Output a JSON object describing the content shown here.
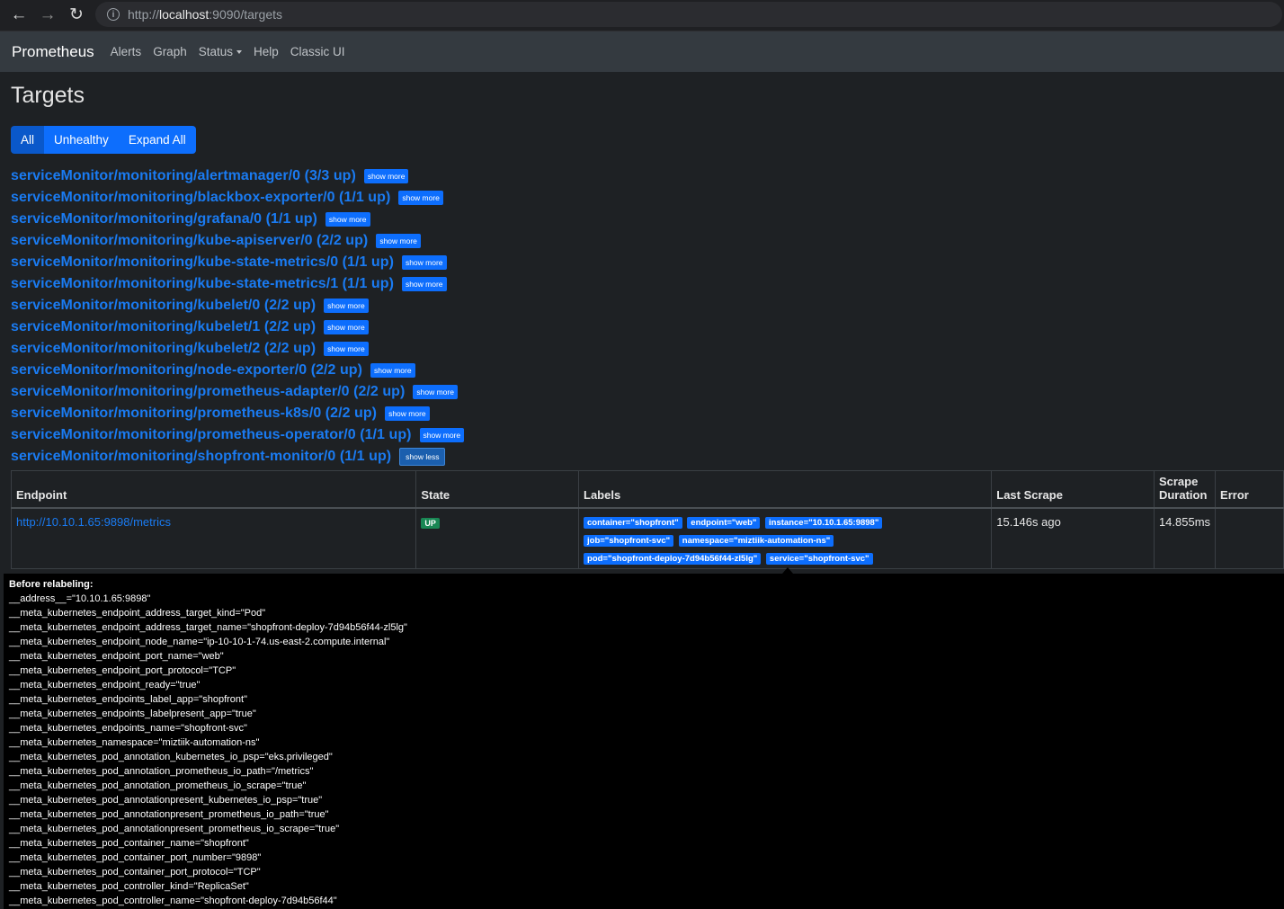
{
  "browser": {
    "url_scheme": "http://",
    "url_host": "localhost",
    "url_path": ":9090/targets"
  },
  "nav": {
    "brand": "Prometheus",
    "links": [
      "Alerts",
      "Graph",
      "Status",
      "Help",
      "Classic UI"
    ]
  },
  "page": {
    "title": "Targets",
    "filters": [
      "All",
      "Unhealthy",
      "Expand All"
    ]
  },
  "pools": [
    {
      "name": "serviceMonitor/monitoring/alertmanager/0 (3/3 up)",
      "button": "show more"
    },
    {
      "name": "serviceMonitor/monitoring/blackbox-exporter/0 (1/1 up)",
      "button": "show more"
    },
    {
      "name": "serviceMonitor/monitoring/grafana/0 (1/1 up)",
      "button": "show more"
    },
    {
      "name": "serviceMonitor/monitoring/kube-apiserver/0 (2/2 up)",
      "button": "show more"
    },
    {
      "name": "serviceMonitor/monitoring/kube-state-metrics/0 (1/1 up)",
      "button": "show more"
    },
    {
      "name": "serviceMonitor/monitoring/kube-state-metrics/1 (1/1 up)",
      "button": "show more"
    },
    {
      "name": "serviceMonitor/monitoring/kubelet/0 (2/2 up)",
      "button": "show more"
    },
    {
      "name": "serviceMonitor/monitoring/kubelet/1 (2/2 up)",
      "button": "show more"
    },
    {
      "name": "serviceMonitor/monitoring/kubelet/2 (2/2 up)",
      "button": "show more"
    },
    {
      "name": "serviceMonitor/monitoring/node-exporter/0 (2/2 up)",
      "button": "show more"
    },
    {
      "name": "serviceMonitor/monitoring/prometheus-adapter/0 (2/2 up)",
      "button": "show more"
    },
    {
      "name": "serviceMonitor/monitoring/prometheus-k8s/0 (2/2 up)",
      "button": "show more"
    },
    {
      "name": "serviceMonitor/monitoring/prometheus-operator/0 (1/1 up)",
      "button": "show more"
    },
    {
      "name": "serviceMonitor/monitoring/shopfront-monitor/0 (1/1 up)",
      "button": "show less"
    }
  ],
  "table": {
    "headers": {
      "endpoint": "Endpoint",
      "state": "State",
      "labels": "Labels",
      "last_scrape": "Last Scrape",
      "scrape_duration_1": "Scrape",
      "scrape_duration_2": "Duration",
      "error": "Error"
    },
    "row": {
      "endpoint": "http://10.10.1.65:9898/metrics",
      "state": "UP",
      "labels": [
        "container=\"shopfront\"",
        "endpoint=\"web\"",
        "instance=\"10.10.1.65:9898\"",
        "job=\"shopfront-svc\"",
        "namespace=\"miztiik-automation-ns\"",
        "pod=\"shopfront-deploy-7d94b56f44-zl5lg\"",
        "service=\"shopfront-svc\""
      ],
      "last_scrape": "15.146s ago",
      "scrape_duration": "14.855ms",
      "error": ""
    }
  },
  "tooltip": {
    "heading": "Before relabeling:",
    "lines": [
      "__address__=\"10.10.1.65:9898\"",
      "__meta_kubernetes_endpoint_address_target_kind=\"Pod\"",
      "__meta_kubernetes_endpoint_address_target_name=\"shopfront-deploy-7d94b56f44-zl5lg\"",
      "__meta_kubernetes_endpoint_node_name=\"ip-10-10-1-74.us-east-2.compute.internal\"",
      "__meta_kubernetes_endpoint_port_name=\"web\"",
      "__meta_kubernetes_endpoint_port_protocol=\"TCP\"",
      "__meta_kubernetes_endpoint_ready=\"true\"",
      "__meta_kubernetes_endpoints_label_app=\"shopfront\"",
      "__meta_kubernetes_endpoints_labelpresent_app=\"true\"",
      "__meta_kubernetes_endpoints_name=\"shopfront-svc\"",
      "__meta_kubernetes_namespace=\"miztiik-automation-ns\"",
      "__meta_kubernetes_pod_annotation_kubernetes_io_psp=\"eks.privileged\"",
      "__meta_kubernetes_pod_annotation_prometheus_io_path=\"/metrics\"",
      "__meta_kubernetes_pod_annotation_prometheus_io_scrape=\"true\"",
      "__meta_kubernetes_pod_annotationpresent_kubernetes_io_psp=\"true\"",
      "__meta_kubernetes_pod_annotationpresent_prometheus_io_path=\"true\"",
      "__meta_kubernetes_pod_annotationpresent_prometheus_io_scrape=\"true\"",
      "__meta_kubernetes_pod_container_name=\"shopfront\"",
      "__meta_kubernetes_pod_container_port_number=\"9898\"",
      "__meta_kubernetes_pod_container_port_protocol=\"TCP\"",
      "__meta_kubernetes_pod_controller_kind=\"ReplicaSet\"",
      "__meta_kubernetes_pod_controller_name=\"shopfront-deploy-7d94b56f44\""
    ]
  },
  "colors": {
    "link": "#1a7bf2",
    "button": "#0d6efd",
    "up_badge": "#198754",
    "navbar": "#343a40",
    "page_bg": "#1e2124"
  }
}
